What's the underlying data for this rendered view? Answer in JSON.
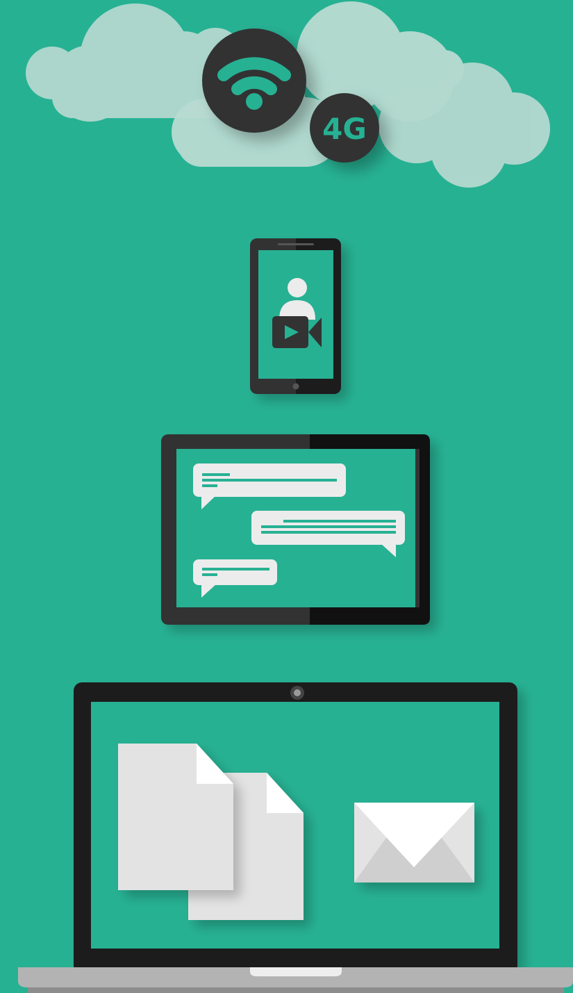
{
  "colors": {
    "background": "#27b193",
    "cloud": "#b4d9cf",
    "device_dark": "#333333",
    "device_black": "#1a1a1a",
    "screen_teal": "#27b193",
    "paper": "#e6e6e6",
    "bubble": "#ececec",
    "accent": "#27b193"
  },
  "network": {
    "badge_4g": "4G",
    "wifi_icon": "wifi-icon"
  },
  "phone": {
    "screen_content": "video-call-icon"
  },
  "tablet": {
    "screen_content": "chat-bubbles"
  },
  "laptop": {
    "screen_content": [
      "document-icon",
      "document-icon",
      "envelope-icon"
    ]
  }
}
